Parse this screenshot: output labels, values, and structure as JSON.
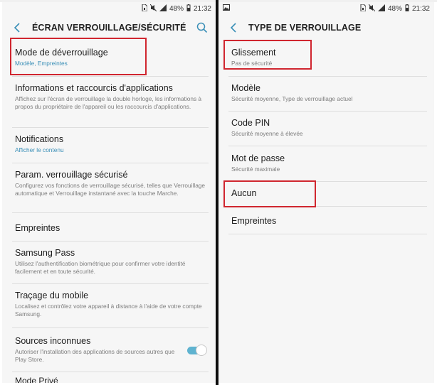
{
  "left": {
    "status": {
      "battery": "48%",
      "time": "21:32"
    },
    "header": {
      "title": "ÉCRAN VERROUILLAGE/SÉCURITÉ"
    },
    "items": [
      {
        "title": "Mode de déverrouillage",
        "subtitle": "Modèle, Empreintes"
      },
      {
        "title": "Informations et raccourcis d'applications",
        "subtitle": "Affichez sur l'écran de verrouillage la double horloge, les informations à propos du propriétaire de l'appareil ou les raccourcis d'applications."
      },
      {
        "title": "Notifications",
        "subtitle": "Afficher le contenu"
      },
      {
        "title": "Param. verrouillage sécurisé",
        "subtitle": "Configurez vos fonctions de verrouillage sécurisé, telles que Verrouillage automatique et Verrouillage instantané avec la touche Marche."
      },
      {
        "title": "Empreintes"
      },
      {
        "title": "Samsung Pass",
        "subtitle": "Utilisez l'authentification biométrique pour confirmer votre identité facilement et en toute sécurité."
      },
      {
        "title": "Traçage du mobile",
        "subtitle": "Localisez et contrôlez votre appareil à distance à l'aide de votre compte Samsung."
      },
      {
        "title": "Sources inconnues",
        "subtitle": "Autoriser l'installation des applications de sources autres que Play Store.",
        "toggle": "on"
      }
    ],
    "cut_text": "Mode Privé"
  },
  "right": {
    "status": {
      "battery": "48%",
      "time": "21:32"
    },
    "header": {
      "title": "TYPE DE VERROUILLAGE"
    },
    "items": [
      {
        "title": "Glissement",
        "subtitle": "Pas de sécurité"
      },
      {
        "title": "Modèle",
        "subtitle": "Sécurité moyenne, Type de verrouillage actuel"
      },
      {
        "title": "Code PIN",
        "subtitle": "Sécurité moyenne à élevée"
      },
      {
        "title": "Mot de passe",
        "subtitle": "Sécurité maximale"
      },
      {
        "title": "Aucun"
      },
      {
        "title": "Empreintes"
      }
    ]
  },
  "colors": {
    "accent": "#3a8fb7",
    "highlight": "#d0262f",
    "background": "#f6f6f6"
  },
  "icons": [
    "back-arrow-icon",
    "search-icon",
    "sd-card-icon",
    "image-icon",
    "mute-icon",
    "signal-icon",
    "battery-icon"
  ]
}
